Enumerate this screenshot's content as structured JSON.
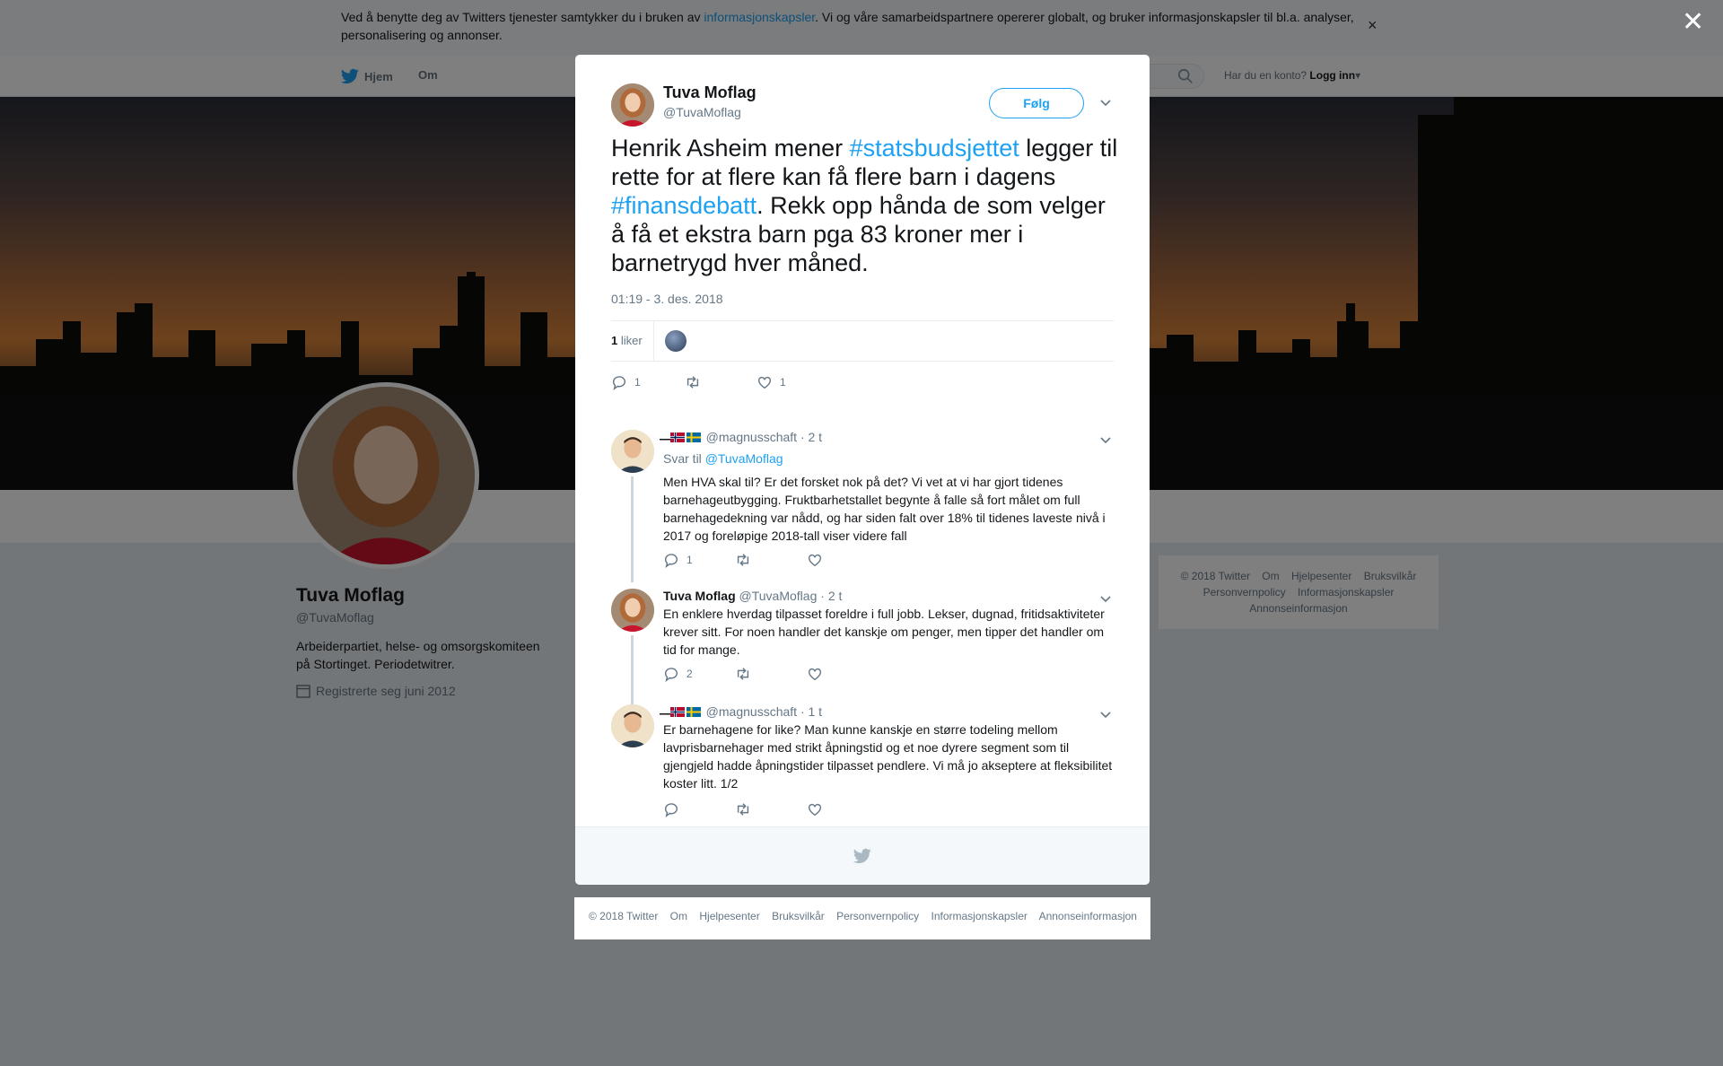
{
  "cookie": {
    "text_before": "Ved å benytte deg av Twitters tjenester samtykker du i bruken av ",
    "link": "informasjonskapsler",
    "text_after": ". Vi og våre samarbeidspartnere opererer globalt, og bruker informasjonskapsler til bl.a. analyser, personalisering og annonser.",
    "close": "×"
  },
  "nav": {
    "home": "Hjem",
    "about": "Om",
    "account_prompt": "Har du en konto?",
    "login": "Logg inn"
  },
  "profile": {
    "name": "Tuva Moflag",
    "handle": "@TuvaMoflag",
    "bio": "Arbeiderpartiet, helse- og omsorgskomiteen på Stortinget. Periodetwitrer.",
    "joined": "Registrerte seg juni 2012"
  },
  "side_footer": {
    "links": [
      "© 2018 Twitter",
      "Om",
      "Hjelpesenter",
      "Bruksvilkår",
      "Personvernpolicy",
      "Informasjonskapsler",
      "Annonseinformasjon"
    ]
  },
  "overlay_close": "✕",
  "tweet": {
    "name": "Tuva Moflag",
    "handle": "@TuvaMoflag",
    "follow": "Følg",
    "text": {
      "p1": "Henrik Asheim mener ",
      "tag1": "#statsbudsjettet",
      "p2": " legger til rette for at flere kan få flere barn i dagens ",
      "tag2": "#finansdebatt",
      "p3": ". Rekk opp hånda de som velger å få et ekstra barn pga 83 kroner mer i barnetrygd hver måned."
    },
    "timestamp": "01:19 - 3. des. 2018",
    "likes_count": "1",
    "likes_label": "liker",
    "reply_count": "1",
    "like_count": "1"
  },
  "replies": [
    {
      "name": "̶̶̶̶̶̶̶ ̶̶̶̶̶̶̶",
      "handle": "@magnusschaft",
      "time": "· 2 t",
      "reply_to_label": "Svar til",
      "reply_to": "@TuvaMoflag",
      "text": "Men HVA skal til? Er det forsket nok på det? Vi vet at vi har gjort tidenes barnehageutbygging. Fruktbarhetstallet begynte å falle så fort målet om full barnehagedekning var nådd, og har siden falt over 18% til tidenes laveste nivå i 2017 og foreløpige 2018-tall viser videre fall",
      "reply_count": "1"
    },
    {
      "name": "Tuva Moflag",
      "handle": "@TuvaMoflag",
      "time": "· 2 t",
      "text": "En enklere hverdag tilpasset foreldre i full jobb. Lekser, dugnad, fritidsaktiviteter krever sitt. For noen handler det kanskje om penger, men tipper det handler om tid for mange.",
      "reply_count": "2"
    },
    {
      "name": "̶̶̶̶̶̶̶ ̶̶̶̶̶̶̶",
      "handle": "@magnusschaft",
      "time": "· 1 t",
      "text": "Er barnehagene for like? Man kunne kanskje en større todeling mellom lavprisbarnehager med strikt åpningstid og et noe dyrere segment som til gjengjeld hadde åpningstider tilpasset pendlere. Vi må jo akseptere at fleksibilitet koster litt. 1/2",
      "reply_count": ""
    }
  ],
  "bottom_footer": {
    "links": [
      "© 2018 Twitter",
      "Om",
      "Hjelpesenter",
      "Bruksvilkår",
      "Personvernpolicy",
      "Informasjonskapsler",
      "Annonseinformasjon"
    ]
  },
  "colors": {
    "accent": "#1da1f2",
    "text": "#14171a",
    "muted": "#657786"
  }
}
